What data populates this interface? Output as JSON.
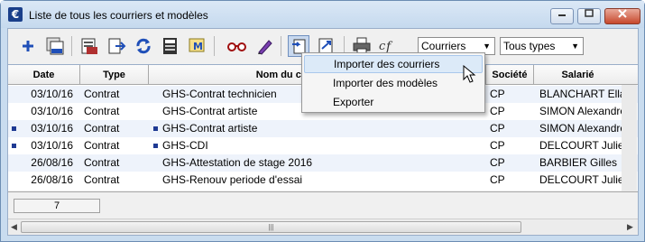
{
  "window": {
    "title": "Liste de tous les courriers et modèles",
    "app_icon_letter": "€"
  },
  "toolbar": {
    "buttons": [
      {
        "name": "add",
        "icon": "plus-icon"
      },
      {
        "name": "duplicate",
        "icon": "duplicate-icon"
      },
      {
        "name": "print-preview",
        "icon": "print-preview-icon"
      },
      {
        "name": "export",
        "icon": "export-icon"
      },
      {
        "name": "refresh",
        "icon": "refresh-icon"
      },
      {
        "name": "calculator",
        "icon": "calculator-icon"
      },
      {
        "name": "mail-merge",
        "icon": "mail-merge-icon"
      },
      {
        "name": "view",
        "icon": "glasses-icon"
      },
      {
        "name": "edit",
        "icon": "pencil-icon"
      },
      {
        "name": "import",
        "icon": "import-icon"
      },
      {
        "name": "import-export",
        "icon": "import-export-icon"
      },
      {
        "name": "print",
        "icon": "printer-icon"
      },
      {
        "name": "formula",
        "icon": "formula-icon"
      }
    ],
    "filter_combo": "Courriers",
    "type_combo": "Tous types"
  },
  "table": {
    "columns": [
      "Date",
      "Type",
      "Nom du courrier",
      "",
      "Société",
      "Salarié"
    ],
    "rows": [
      {
        "date": "03/10/16",
        "type": "Contrat",
        "nom": "GHS-Contrat technicien",
        "societe": "CP",
        "salarie": "BLANCHART Ella",
        "marked": false
      },
      {
        "date": "03/10/16",
        "type": "Contrat",
        "nom": "GHS-Contrat artiste",
        "societe": "CP",
        "salarie": "SIMON Alexandre",
        "marked": false
      },
      {
        "date": "03/10/16",
        "type": "Contrat",
        "nom": "GHS-Contrat artiste",
        "societe": "CP",
        "salarie": "SIMON Alexandre",
        "marked": true
      },
      {
        "date": "03/10/16",
        "type": "Contrat",
        "nom": "GHS-CDI",
        "societe": "CP",
        "salarie": "DELCOURT Julie",
        "marked": true
      },
      {
        "date": "26/08/16",
        "type": "Contrat",
        "nom": "GHS-Attestation de stage 2016",
        "societe": "CP",
        "salarie": "BARBIER Gilles",
        "marked": false
      },
      {
        "date": "26/08/16",
        "type": "Contrat",
        "nom": "GHS-Renouv periode d'essai",
        "societe": "CP",
        "salarie": "DELCOURT Julie",
        "marked": false
      }
    ]
  },
  "footer": {
    "count": "7"
  },
  "context_menu": {
    "items": [
      "Importer des courriers",
      "Importer des modèles",
      "Exporter"
    ],
    "highlighted": "Importer des courriers"
  },
  "colors": {
    "title_bg": "#c5d9ee",
    "alt_row": "#eef3fb",
    "bullet": "#1f3a93",
    "menu_highlight": "#dceaf8"
  }
}
